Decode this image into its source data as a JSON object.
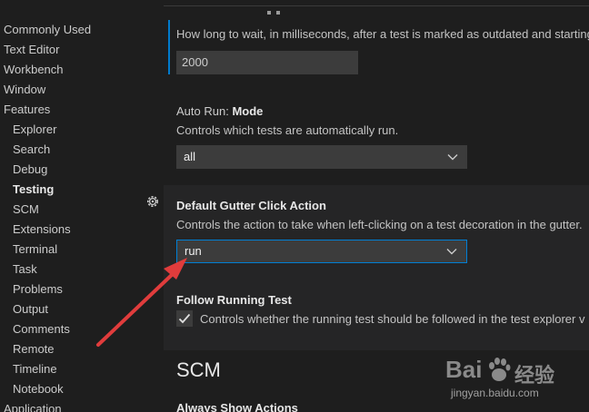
{
  "sidebar": {
    "items": [
      {
        "label": "Commonly Used",
        "level": 0
      },
      {
        "label": "Text Editor",
        "level": 0
      },
      {
        "label": "Workbench",
        "level": 0
      },
      {
        "label": "Window",
        "level": 0
      },
      {
        "label": "Features",
        "level": 0
      },
      {
        "label": "Explorer",
        "level": 1
      },
      {
        "label": "Search",
        "level": 1
      },
      {
        "label": "Debug",
        "level": 1
      },
      {
        "label": "Testing",
        "level": 1,
        "active": true
      },
      {
        "label": "SCM",
        "level": 1
      },
      {
        "label": "Extensions",
        "level": 1
      },
      {
        "label": "Terminal",
        "level": 1
      },
      {
        "label": "Task",
        "level": 1
      },
      {
        "label": "Problems",
        "level": 1
      },
      {
        "label": "Output",
        "level": 1
      },
      {
        "label": "Comments",
        "level": 1
      },
      {
        "label": "Remote",
        "level": 1
      },
      {
        "label": "Timeline",
        "level": 1
      },
      {
        "label": "Notebook",
        "level": 1
      },
      {
        "label": "Application",
        "level": 0
      }
    ]
  },
  "settings": {
    "outdated_delay": {
      "description": "How long to wait, in milliseconds, after a test is marked as outdated and starting",
      "value": "2000"
    },
    "auto_run_mode": {
      "category": "Auto Run: ",
      "name": "Mode",
      "description": "Controls which tests are automatically run.",
      "value": "all"
    },
    "gutter_click_action": {
      "name": "Default Gutter Click Action",
      "description": "Controls the action to take when left-clicking on a test decoration in the gutter.",
      "value": "run"
    },
    "follow_running_test": {
      "name": "Follow Running Test",
      "description": "Controls whether the running test should be followed in the test explorer v",
      "checked": true
    },
    "scm_section_title": "SCM",
    "always_show_actions": {
      "name": "Always Show Actions"
    }
  },
  "watermark": {
    "brand": "Bai",
    "brand2": "经验",
    "url": "jingyan.baidu.com"
  },
  "colors": {
    "accent": "#007fd4",
    "annotation_arrow": "#e03c3c"
  },
  "icons": {
    "settings": "gear-icon",
    "dropdown": "chevron-down-icon",
    "check": "check-icon"
  }
}
